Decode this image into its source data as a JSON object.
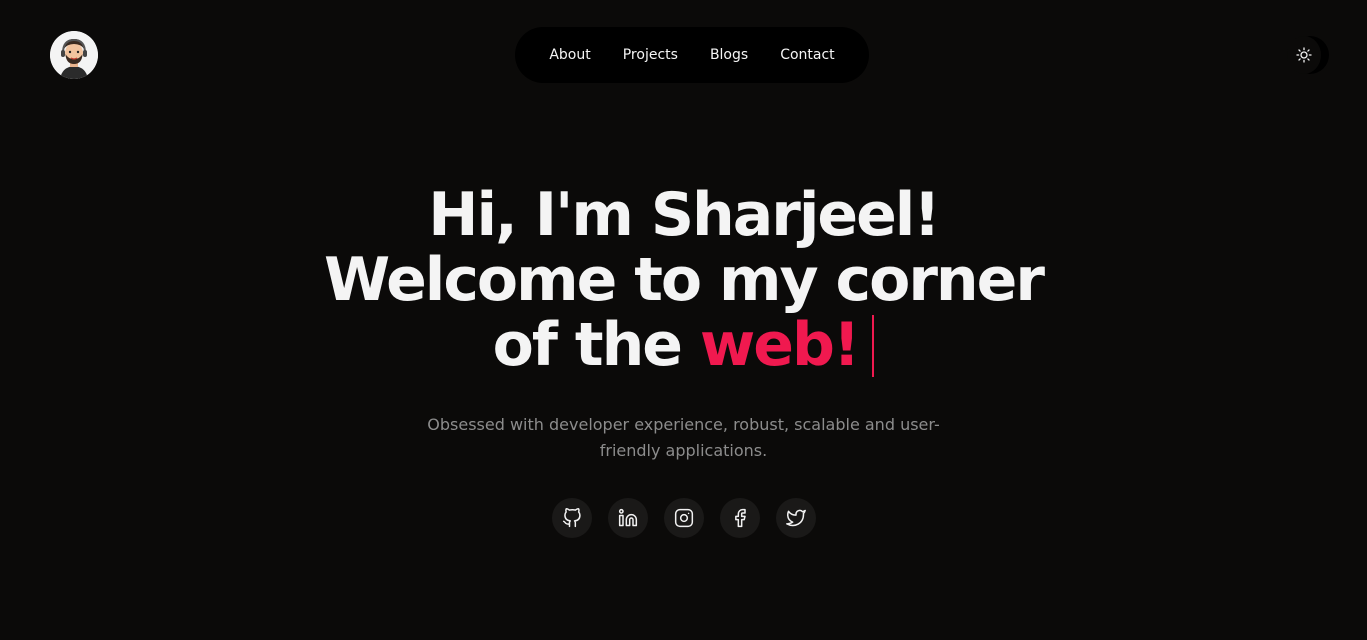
{
  "header": {
    "avatar_icon": "developer-avatar-icon",
    "nav": [
      {
        "label": "About"
      },
      {
        "label": "Projects"
      },
      {
        "label": "Blogs"
      },
      {
        "label": "Contact"
      }
    ],
    "theme_toggle_icon": "sun-icon"
  },
  "hero": {
    "line1": "Hi, I'm Sharjeel!",
    "line2": "Welcome to my corner",
    "line3_prefix": "of the ",
    "line3_accent": "web!",
    "subtitle": "Obsessed with developer experience, robust, scalable and user-friendly applications.",
    "socials": [
      {
        "icon": "github-icon"
      },
      {
        "icon": "linkedin-icon"
      },
      {
        "icon": "instagram-icon"
      },
      {
        "icon": "facebook-icon"
      },
      {
        "icon": "twitter-icon"
      }
    ]
  },
  "colors": {
    "background": "#0b0a09",
    "accent": "#f0194f",
    "text": "#f4f4f4",
    "muted": "#8c8c8c"
  }
}
